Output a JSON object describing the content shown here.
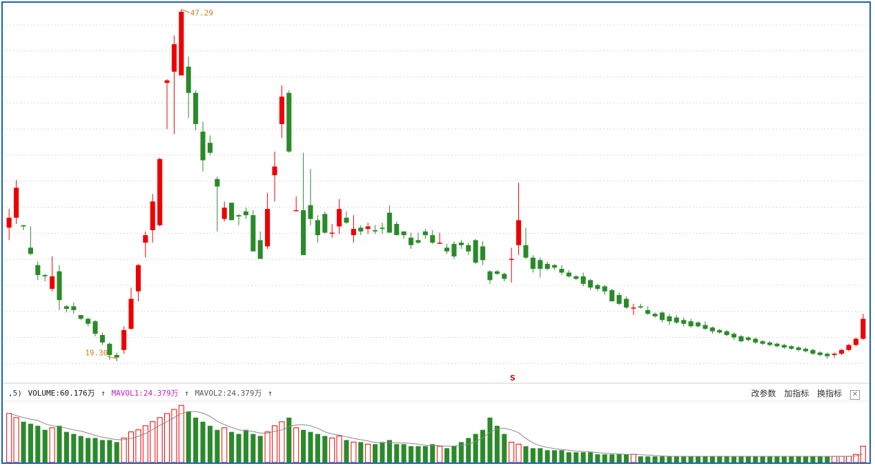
{
  "volume_header": {
    "prefix": ",5)",
    "volume_label": "VOLUME:60.176万",
    "mavol1_label": "MAVOL1:24.379万",
    "mavol2_label": "MAVOL2:24.379万",
    "arrow": "↑"
  },
  "tools": {
    "params": "改参数",
    "add_indicator": "加指标",
    "switch_indicator": "换指标",
    "close": "✕"
  },
  "colors": {
    "up": "#ee0000",
    "down": "#2a8a2a",
    "ma": "#888888",
    "annotation": "#d07a20",
    "frame": "#1e5fb5",
    "grid": "#d8d8d8"
  },
  "chart_data": [
    {
      "type": "candlestick",
      "ylim": [
        18,
        47.6
      ],
      "annotations": [
        {
          "text": "47.29",
          "value": 47.29,
          "kind": "high"
        },
        {
          "text": "19.30",
          "value": 19.3,
          "kind": "low"
        },
        {
          "text": "S",
          "kind": "marker"
        }
      ],
      "candles": [
        [
          29.8,
          30.6,
          31.3,
          28.8
        ],
        [
          30.6,
          33.0,
          33.6,
          30.1
        ],
        [
          30.0,
          29.9,
          30.0,
          29.6
        ],
        [
          28.2,
          27.7,
          29.9,
          27.6
        ],
        [
          26.8,
          26.0,
          27.1,
          25.6
        ],
        [
          26.0,
          25.9,
          26.1,
          25.5
        ],
        [
          24.9,
          25.9,
          27.5,
          24.7
        ],
        [
          26.3,
          24.0,
          26.8,
          23.2
        ],
        [
          23.5,
          23.3,
          23.6,
          23.0
        ],
        [
          23.5,
          23.2,
          23.8,
          22.9
        ],
        [
          22.8,
          22.5,
          22.8,
          22.4
        ],
        [
          22.5,
          22.1,
          22.6,
          21.9
        ],
        [
          22.3,
          21.3,
          22.4,
          21.1
        ],
        [
          21.2,
          20.6,
          21.4,
          20.4
        ],
        [
          20.5,
          19.6,
          20.6,
          19.2
        ],
        [
          19.6,
          19.4,
          19.8,
          19.1
        ],
        [
          20.0,
          21.6,
          21.9,
          19.7
        ],
        [
          21.7,
          24.1,
          25.0,
          21.6
        ],
        [
          24.7,
          26.8,
          26.9,
          23.9
        ],
        [
          28.6,
          29.2,
          29.5,
          27.4
        ],
        [
          29.6,
          31.9,
          32.5,
          28.6
        ],
        [
          30.0,
          35.3,
          35.4,
          29.9
        ],
        [
          41.4,
          41.6,
          41.7,
          37.7
        ],
        [
          42.3,
          44.5,
          45.2,
          37.3
        ],
        [
          42.0,
          47.1,
          47.3,
          42.0
        ],
        [
          42.7,
          40.6,
          43.5,
          38.6
        ],
        [
          40.6,
          38.1,
          40.8,
          37.6
        ],
        [
          37.5,
          35.2,
          38.3,
          34.3
        ],
        [
          36.6,
          35.8,
          37.2,
          35.6
        ],
        [
          33.7,
          33.1,
          33.9,
          29.5
        ],
        [
          30.5,
          31.4,
          31.9,
          30.3
        ],
        [
          31.8,
          30.4,
          31.8,
          30.4
        ],
        [
          30.8,
          30.7,
          30.9,
          30.0
        ],
        [
          31.1,
          30.8,
          31.4,
          30.5
        ],
        [
          30.8,
          27.9,
          31.2,
          27.9
        ],
        [
          28.8,
          27.3,
          29.5,
          27.3
        ],
        [
          28.3,
          31.3,
          32.6,
          28.1
        ],
        [
          34.0,
          34.7,
          35.9,
          31.9
        ],
        [
          38.1,
          40.3,
          41.2,
          37.0
        ],
        [
          40.6,
          35.9,
          40.8,
          35.8
        ],
        [
          31.2,
          31.2,
          32.3,
          31.2
        ],
        [
          31.2,
          27.6,
          35.8,
          27.6
        ],
        [
          31.6,
          30.5,
          34.5,
          30.0
        ],
        [
          30.4,
          29.2,
          30.8,
          28.6
        ],
        [
          30.9,
          29.4,
          31.1,
          29.3
        ],
        [
          29.4,
          29.4,
          30.1,
          29.0
        ],
        [
          29.9,
          31.3,
          32.1,
          29.3
        ],
        [
          30.6,
          30.2,
          31.1,
          30.1
        ],
        [
          29.2,
          29.7,
          30.8,
          28.6
        ],
        [
          29.8,
          29.5,
          30.0,
          29.2
        ],
        [
          29.7,
          29.9,
          30.2,
          29.3
        ],
        [
          29.6,
          29.5,
          30.0,
          29.3
        ],
        [
          29.8,
          29.7,
          30.2,
          29.3
        ],
        [
          31.0,
          29.4,
          31.6,
          29.4
        ],
        [
          30.1,
          29.2,
          30.3,
          29.2
        ],
        [
          29.5,
          29.2,
          29.5,
          28.9
        ],
        [
          29.0,
          28.4,
          29.4,
          28.1
        ],
        [
          28.8,
          28.6,
          29.4,
          28.5
        ],
        [
          29.5,
          29.2,
          29.7,
          28.9
        ],
        [
          29.2,
          28.6,
          29.6,
          28.5
        ],
        [
          28.6,
          28.6,
          29.4,
          28.5
        ],
        [
          28.2,
          27.9,
          28.5,
          27.7
        ],
        [
          28.5,
          27.5,
          28.7,
          27.3
        ],
        [
          28.6,
          28.4,
          28.8,
          28.1
        ],
        [
          28.4,
          27.9,
          28.6,
          27.6
        ],
        [
          28.8,
          27.0,
          28.9,
          26.9
        ],
        [
          28.3,
          27.2,
          28.7,
          26.8
        ],
        [
          26.3,
          25.6,
          26.4,
          25.3
        ],
        [
          26.3,
          26.1,
          26.4,
          26.0
        ],
        [
          26.1,
          25.7,
          26.2,
          25.5
        ],
        [
          27.3,
          27.3,
          28.2,
          25.4
        ],
        [
          28.4,
          30.4,
          33.4,
          27.6
        ],
        [
          28.4,
          27.4,
          29.8,
          27.3
        ],
        [
          27.4,
          26.5,
          27.6,
          26.2
        ],
        [
          27.2,
          26.5,
          27.4,
          25.8
        ],
        [
          26.9,
          26.5,
          27.1,
          26.4
        ],
        [
          26.8,
          26.6,
          26.9,
          26.4
        ],
        [
          26.5,
          26.2,
          26.8,
          26.0
        ],
        [
          26.2,
          25.9,
          26.4,
          25.8
        ],
        [
          25.9,
          25.7,
          26.0,
          25.6
        ],
        [
          25.9,
          25.3,
          26.2,
          25.1
        ],
        [
          25.6,
          25.0,
          25.7,
          24.8
        ],
        [
          25.2,
          24.9,
          25.3,
          24.7
        ],
        [
          25.1,
          24.7,
          25.2,
          24.4
        ],
        [
          24.8,
          23.9,
          24.9,
          23.9
        ],
        [
          24.4,
          23.7,
          24.6,
          23.6
        ],
        [
          24.1,
          23.4,
          24.3,
          23.3
        ],
        [
          23.4,
          23.4,
          23.7,
          22.8
        ],
        [
          23.5,
          23.4,
          23.7,
          23.3
        ],
        [
          23.2,
          22.9,
          23.5,
          22.8
        ],
        [
          22.9,
          22.7,
          23.0,
          22.6
        ],
        [
          23.0,
          22.4,
          23.1,
          22.2
        ],
        [
          22.7,
          22.3,
          22.9,
          22.0
        ],
        [
          22.6,
          22.2,
          22.8,
          22.1
        ],
        [
          22.4,
          22.1,
          22.6,
          21.9
        ],
        [
          22.3,
          21.9,
          22.5,
          21.8
        ],
        [
          22.2,
          21.9,
          22.3,
          21.8
        ],
        [
          22.0,
          21.7,
          22.3,
          21.6
        ],
        [
          21.8,
          21.5,
          21.9,
          21.3
        ],
        [
          21.6,
          21.4,
          21.7,
          21.3
        ],
        [
          21.5,
          21.2,
          21.6,
          21.1
        ],
        [
          21.3,
          21.0,
          21.4,
          20.8
        ],
        [
          21.1,
          20.7,
          21.2,
          20.6
        ],
        [
          21.0,
          20.8,
          21.1,
          20.7
        ],
        [
          20.9,
          20.6,
          21.0,
          20.5
        ],
        [
          20.7,
          20.5,
          20.8,
          20.4
        ],
        [
          20.6,
          20.4,
          20.7,
          20.3
        ],
        [
          20.5,
          20.3,
          20.6,
          20.2
        ],
        [
          20.4,
          20.2,
          20.5,
          20.1
        ],
        [
          20.3,
          20.1,
          20.4,
          20.0
        ],
        [
          20.2,
          20.0,
          20.3,
          19.9
        ],
        [
          20.1,
          19.9,
          20.2,
          19.8
        ],
        [
          20.0,
          19.7,
          20.1,
          19.6
        ],
        [
          19.8,
          19.6,
          19.9,
          19.5
        ],
        [
          19.7,
          19.5,
          19.8,
          19.3
        ],
        [
          19.6,
          19.7,
          19.8,
          19.4
        ],
        [
          19.7,
          20.0,
          20.1,
          19.6
        ],
        [
          20.0,
          20.4,
          20.5,
          19.9
        ],
        [
          20.4,
          20.9,
          21.0,
          20.3
        ],
        [
          20.9,
          22.5,
          22.9,
          20.8
        ]
      ]
    },
    {
      "type": "bar",
      "title": "VOLUME",
      "volumes": [
        24,
        22,
        20,
        19,
        18,
        16,
        17,
        18,
        15,
        14,
        13,
        12,
        12,
        11,
        11,
        10,
        12,
        15,
        16,
        18,
        20,
        22,
        24,
        26,
        28,
        25,
        22,
        20,
        18,
        16,
        17,
        15,
        14,
        16,
        14,
        13,
        15,
        18,
        20,
        22,
        17,
        16,
        15,
        14,
        13,
        12,
        13,
        11,
        10,
        10,
        9,
        9,
        10,
        11,
        9,
        9,
        8,
        8,
        8,
        9,
        8,
        7,
        8,
        10,
        12,
        14,
        16,
        22,
        18,
        14,
        10,
        9,
        8,
        7,
        7,
        6,
        6,
        6,
        5,
        5,
        5,
        5,
        4,
        4,
        4,
        4,
        4,
        4,
        3,
        3,
        3,
        3,
        3,
        3,
        3,
        3,
        3,
        3,
        3,
        3,
        3,
        3,
        3,
        3,
        3,
        3,
        3,
        3,
        3,
        3,
        3,
        3,
        3,
        3,
        3,
        3,
        3,
        3,
        4,
        8
      ]
    }
  ]
}
